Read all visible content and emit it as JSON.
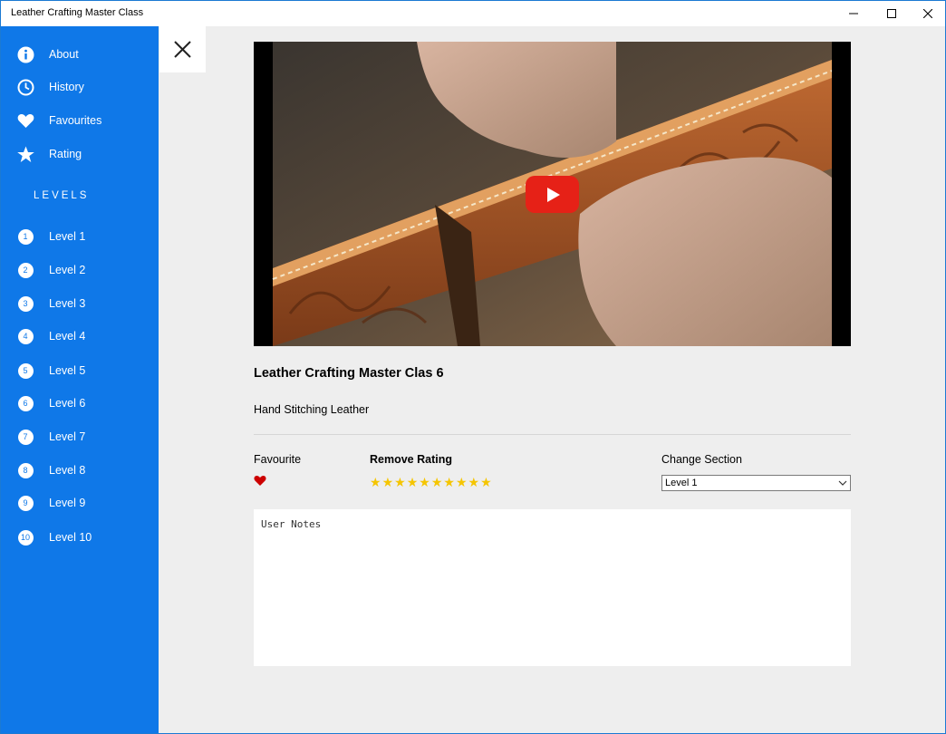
{
  "window": {
    "title": "Leather Crafting Master Class"
  },
  "sidebar": {
    "items": [
      {
        "label": "About",
        "icon": "info-icon"
      },
      {
        "label": "History",
        "icon": "clock-icon"
      },
      {
        "label": "Favourites",
        "icon": "heart-icon"
      },
      {
        "label": "Rating",
        "icon": "star-icon"
      }
    ],
    "levels_heading": "LEVELS",
    "levels": [
      {
        "num": "1",
        "label": "Level 1"
      },
      {
        "num": "2",
        "label": "Level 2"
      },
      {
        "num": "3",
        "label": "Level 3"
      },
      {
        "num": "4",
        "label": "Level 4"
      },
      {
        "num": "5",
        "label": "Level 5"
      },
      {
        "num": "6",
        "label": "Level 6"
      },
      {
        "num": "7",
        "label": "Level 7"
      },
      {
        "num": "8",
        "label": "Level 8"
      },
      {
        "num": "9",
        "label": "Level 9"
      },
      {
        "num": "10",
        "label": "Level 10"
      }
    ]
  },
  "main": {
    "video_title": "Leather Crafting Master Clas 6",
    "video_subtitle": "Hand Stitching Leather",
    "favourite_label": "Favourite",
    "rating_label": "Remove Rating",
    "rating_stars": 10,
    "section_label": "Change Section",
    "section_selected": "Level 1",
    "notes_placeholder": "User Notes"
  },
  "colors": {
    "sidebar": "#0f78e8",
    "accent_red": "#e62117",
    "star": "#f5c500",
    "heart": "#cc0000"
  }
}
